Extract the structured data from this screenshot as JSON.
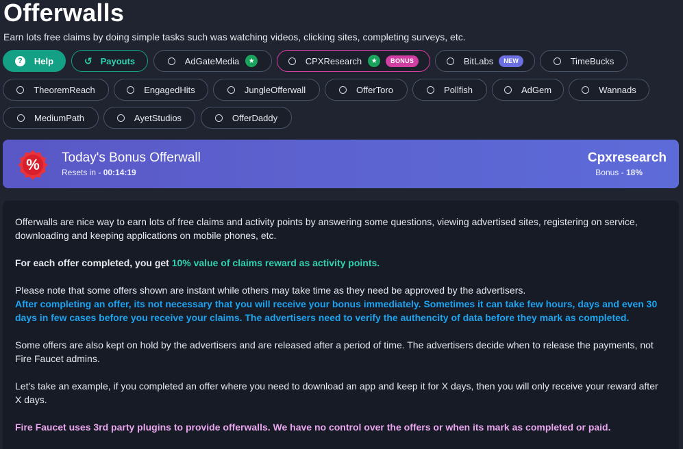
{
  "page": {
    "title": "Offerwalls",
    "subtitle": "Earn lots free claims by doing simple tasks such was watching videos, clicking sites, completing surveys, etc."
  },
  "buttons": {
    "help": "Help",
    "payouts": "Payouts"
  },
  "offerwalls": [
    {
      "label": "AdGateMedia",
      "star": true
    },
    {
      "label": "CPXResearch",
      "star": true,
      "badge": "BONUS"
    },
    {
      "label": "BitLabs",
      "badge": "NEW"
    },
    {
      "label": "TimeBucks"
    },
    {
      "label": "TheoremReach"
    },
    {
      "label": "EngagedHits"
    },
    {
      "label": "JungleOfferwall"
    },
    {
      "label": "OfferToro"
    },
    {
      "label": "Pollfish"
    },
    {
      "label": "AdGem"
    },
    {
      "label": "Wannads"
    },
    {
      "label": "MediumPath"
    },
    {
      "label": "AyetStudios"
    },
    {
      "label": "OfferDaddy"
    }
  ],
  "bonus": {
    "title": "Today's Bonus Offerwall",
    "reset_label": "Resets in - ",
    "reset_time": "00:14:19",
    "name": "Cpxresearch",
    "bonus_label": "Bonus - ",
    "bonus_value": "18%",
    "icon_symbol": "%"
  },
  "info": {
    "p1": "Offerwalls are nice way to earn lots of free claims and activity points by answering some questions, viewing advertised sites, registering on service, downloading and keeping applications on mobile phones, etc.",
    "p2_prefix": "For each offer completed, you get ",
    "p2_highlight": "10% value of claims reward as activity points.",
    "p3": "Please note that some offers shown are instant while others may take time as they need be approved by the advertisers.",
    "p3_blue": "After completing an offer, its not necessary that you will receive your bonus immediately. Sometimes it can take few hours, days and even 30 days in few cases before you receive your claims. The advertisers need to verify the authencity of data before they mark as completed.",
    "p4": "Some offers are also kept on hold by the advertisers and are released after a period of time. The advertisers decide when to release the payments, not Fire Faucet admins.",
    "p5": "Let's take an example, if you completed an offer where you need to download an app and keep it for X days, then you will only receive your reward after X days.",
    "p6": "Fire Faucet uses 3rd party plugins to provide offerwalls. We have no control over the offers or when its mark as completed or paid."
  },
  "colors": {
    "accent_teal": "#14a085",
    "bonus_pink": "#d13fa2",
    "new_purple": "#6c6fe0",
    "banner": "#5c63d0"
  }
}
